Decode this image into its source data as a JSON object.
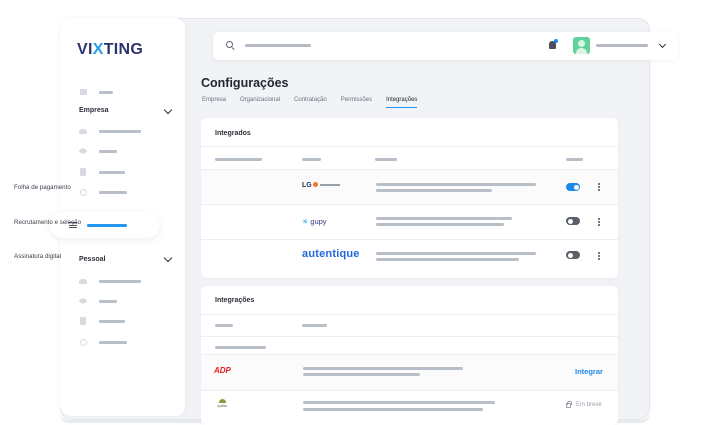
{
  "brand": {
    "logo_pre": "VI",
    "logo_x": "X",
    "logo_post": "TING",
    "color_dark": "#2d3570",
    "color_accent": "#22a0f0"
  },
  "sidebar": {
    "section_company": "Empresa",
    "section_personal": "Pessoal",
    "icons": [
      "home-icon",
      "people-icon",
      "rocket-icon",
      "document-icon",
      "smile-icon"
    ]
  },
  "header": {
    "search_icon": "search-icon",
    "bell_icon": "bell-icon",
    "avatar": "user-avatar"
  },
  "page": {
    "title": "Configurações",
    "tabs": [
      {
        "label": "Empresa"
      },
      {
        "label": "Organizacional"
      },
      {
        "label": "Contratação"
      },
      {
        "label": "Permissões"
      },
      {
        "label": "Integrações",
        "active": true
      }
    ]
  },
  "integrated": {
    "title": "Integrados",
    "rows": [
      {
        "label": "Folha de pagamento",
        "logo": "LG",
        "enabled": true
      },
      {
        "label": "Recrutamento e seleção",
        "logo": "gupy",
        "enabled": false
      },
      {
        "label": "Assinatura digital",
        "logo": "autentique",
        "enabled": false
      }
    ]
  },
  "integrations": {
    "title": "Integrações",
    "rows": [
      {
        "logo": "ADP",
        "action": "Integrar"
      },
      {
        "logo": "qulità",
        "status": "Em breve"
      }
    ]
  },
  "colors": {
    "primary": "#2196f3",
    "toggle_on": "#1e88e5",
    "toggle_off": "#5a5f68"
  }
}
